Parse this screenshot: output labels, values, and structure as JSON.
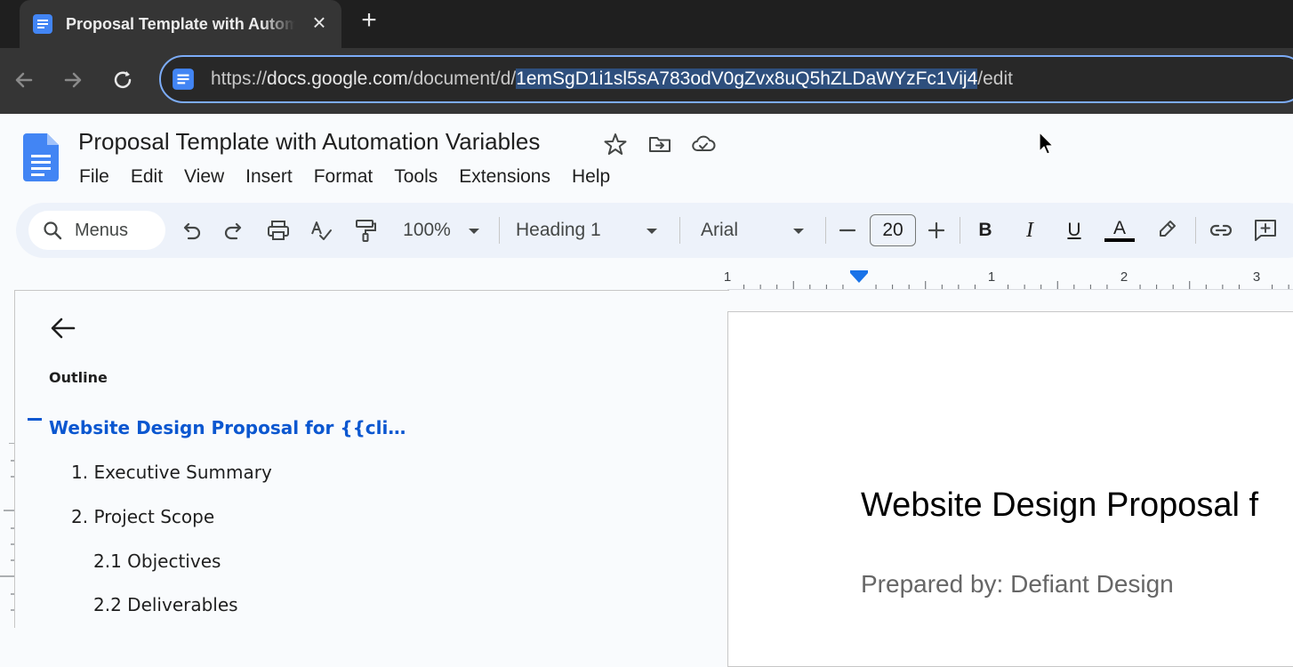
{
  "browser": {
    "tab_title": "Proposal Template with Automation Variables",
    "url_prefix": "https://",
    "url_host": "docs.google.com",
    "url_path": "/document/d/",
    "url_selected": "1emSgD1i1sl5sA783odV0gZvx8uQ5hZLDaWYzFc1Vij4",
    "url_suffix": "/edit"
  },
  "docs": {
    "title": "Proposal Template with Automation Variables",
    "menu": [
      "File",
      "Edit",
      "View",
      "Insert",
      "Format",
      "Tools",
      "Extensions",
      "Help"
    ]
  },
  "toolbar": {
    "search_placeholder": "Menus",
    "zoom": "100%",
    "style": "Heading 1",
    "font": "Arial",
    "font_size": "20",
    "bold": "B",
    "italic": "I",
    "underline": "U",
    "text_color": "A",
    "text_color_hex": "#000000"
  },
  "ruler": {
    "labels": [
      "1",
      "1",
      "2",
      "3"
    ]
  },
  "outline": {
    "label": "Outline",
    "items": [
      {
        "text": "Website Design Proposal for {{cli…",
        "active": true
      },
      {
        "text": "1. Executive Summary",
        "active": false
      },
      {
        "text": "2. Project Scope",
        "active": false
      },
      {
        "text": "2.1 Objectives",
        "active": false
      },
      {
        "text": "2.2 Deliverables",
        "active": false
      }
    ]
  },
  "page": {
    "heading": "Website Design Proposal f",
    "prepared_by": "Prepared by: Defiant Design"
  },
  "colors": {
    "accent": "#0b57d0",
    "selection": "#2e4f7d",
    "omnibox_border": "#7cacf8",
    "docs_blue": "#4285f4"
  }
}
